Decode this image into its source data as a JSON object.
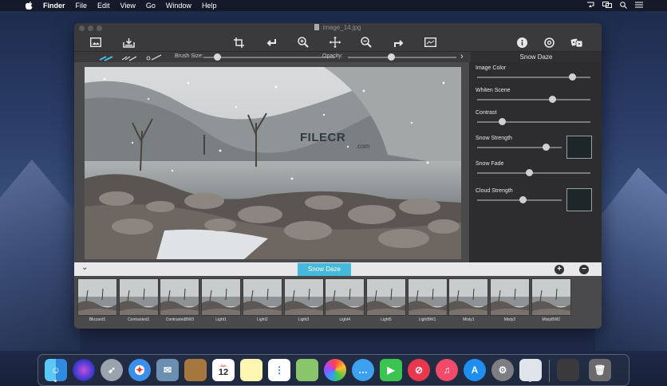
{
  "menubar": {
    "apple": "",
    "items": [
      "Finder",
      "File",
      "Edit",
      "View",
      "Go",
      "Window",
      "Help"
    ]
  },
  "window": {
    "title": "image_14.jpg"
  },
  "toolbar": {
    "icons": [
      "image-icon",
      "export-icon",
      "crop-icon",
      "rotate-icon",
      "zoom-in-icon",
      "move-icon",
      "zoom-out-icon",
      "redo-icon",
      "compare-icon",
      "info-icon",
      "help-icon",
      "randomize-icon"
    ]
  },
  "subbar": {
    "brush_size_label": "Brush Size:",
    "brush_size": 0.1,
    "opacity_label": "Opacity:",
    "opacity": 0.4,
    "panel_title": "Snow Daze"
  },
  "params": [
    {
      "label": "Image Color",
      "value": 0.84,
      "swatch": false
    },
    {
      "label": "Whiten Scene",
      "value": 0.66,
      "swatch": false
    },
    {
      "label": "Contrast",
      "value": 0.22,
      "swatch": false
    },
    {
      "label": "Snow Strength",
      "value": 0.81,
      "swatch": true
    },
    {
      "label": "Snow Fade",
      "value": 0.46,
      "swatch": false
    },
    {
      "label": "Cloud Strength",
      "value": 0.54,
      "swatch": true
    }
  ],
  "watermark": {
    "brand": "FILECR",
    "suffix": ".com"
  },
  "preset_bar": {
    "selected": "Snow Daze",
    "add": "+",
    "remove": "−"
  },
  "presets": [
    "Blizzard1",
    "Contrasted1",
    "ContrastedBW3",
    "Light1",
    "Light2",
    "Light3",
    "Light4",
    "Light5",
    "LightBW1",
    "Misty1",
    "Misty2",
    "MistyBW2"
  ],
  "dock": {
    "calendar_month": "JUL",
    "calendar_day": "12"
  },
  "colors": {
    "accent": "#46b8dc",
    "window_bg": "#2b2b2d",
    "panel_bg": "#2d2d2f"
  }
}
